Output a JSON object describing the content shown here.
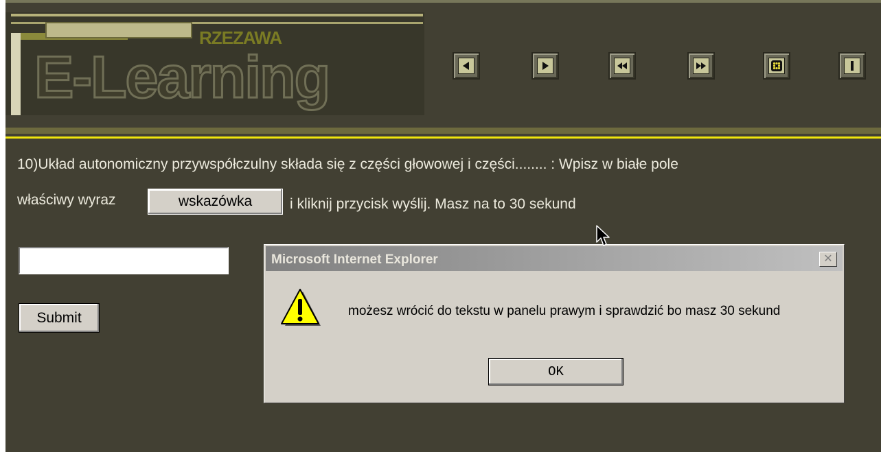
{
  "header": {
    "brand_sub": "RZEZAWA",
    "brand": "E-Learning",
    "nav_buttons": [
      {
        "icon": "previous-icon"
      },
      {
        "icon": "next-icon"
      },
      {
        "icon": "rewind-icon"
      },
      {
        "icon": "fast-forward-icon"
      },
      {
        "icon": "menu-grid-icon"
      },
      {
        "icon": "info-icon"
      }
    ]
  },
  "question": {
    "line1": "10)Układ autonomiczny przywspółczulny składa się z części głowowej i części........ : Wpisz w białe pole",
    "line2_start": "właściwy wyraz",
    "hint_label": "wskazówka",
    "line2_end": "i kliknij przycisk wyślij. Masz na to 30 sekund"
  },
  "form": {
    "answer_value": "",
    "submit_label": "Submit"
  },
  "dialog": {
    "title": "Microsoft Internet Explorer",
    "close_label": "✕",
    "message": "możesz wrócić do tekstu w panelu prawym i sprawdzić bo masz 30 sekund",
    "ok_label": "OK"
  },
  "colors": {
    "background": "#424033",
    "accent_yellow": "#f0e60c",
    "dialog_gray": "#d4d0c8"
  }
}
